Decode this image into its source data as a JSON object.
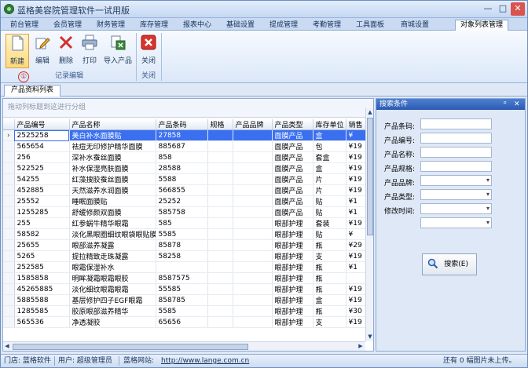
{
  "window": {
    "title": "蓝格美容院管理软件一试用版",
    "min": "—",
    "max": "□",
    "close": "✕"
  },
  "menu_tabs": [
    "前台管理",
    "会员管理",
    "财务管理",
    "库存管理",
    "报表中心",
    "基础设置",
    "提成管理",
    "考勤管理",
    "工具面板",
    "商城设置",
    "对象列表管理"
  ],
  "ribbon": {
    "buttons": {
      "new": "新建",
      "edit": "编辑",
      "delete": "删除",
      "print": "打印",
      "import": "导入产品",
      "close": "关闭"
    },
    "groups": {
      "records": "记录编辑",
      "close": "关闭"
    },
    "badge": "①"
  },
  "doc_tab": "产品资料列表",
  "grid": {
    "group_hint": "拖动列标题到这进行分组",
    "columns": [
      "产品编号",
      "产品名称",
      "产品条码",
      "规格",
      "产品品牌",
      "产品类型",
      "库存单位",
      "销售"
    ],
    "current_row_marker": "›",
    "rows": [
      [
        "2525258",
        "美白补水面膜贴",
        "27858",
        "",
        "",
        "面膜产品",
        "盒",
        "¥"
      ],
      [
        "565654",
        "祛痘无印修护精华面膜",
        "885687",
        "",
        "",
        "面膜产品",
        "包",
        "¥19"
      ],
      [
        "256",
        "深补水蚕丝面膜",
        "858",
        "",
        "",
        "面膜产品",
        "套盒",
        "¥19"
      ],
      [
        "522525",
        "补水保湿亮肤面膜",
        "28588",
        "",
        "",
        "面膜产品",
        "盒",
        "¥19"
      ],
      [
        "54255",
        "红藻搜胶蚕丝面膜",
        "5588",
        "",
        "",
        "面膜产品",
        "片",
        "¥19"
      ],
      [
        "452885",
        "天然滋养水润面膜",
        "566855",
        "",
        "",
        "面膜产品",
        "片",
        "¥19"
      ],
      [
        "25552",
        "睡眠面膜贴",
        "25252",
        "",
        "",
        "面膜产品",
        "贴",
        "¥1"
      ],
      [
        "1255285",
        "舒缓修颜双面膜",
        "585758",
        "",
        "",
        "面膜产品",
        "贴",
        "¥1"
      ],
      [
        "255",
        "红参蜗牛精华眼霜",
        "585",
        "",
        "",
        "眼部护理",
        "套装",
        "¥19"
      ],
      [
        "58582",
        "淡化黑眼圈细纹眼袋眼贴膜",
        "5585",
        "",
        "",
        "眼部护理",
        "贴",
        "¥"
      ],
      [
        "25655",
        "眼部滋养凝露",
        "85878",
        "",
        "",
        "眼部护理",
        "瓶",
        "¥29"
      ],
      [
        "5265",
        "提拉精致走珠凝露",
        "58258",
        "",
        "",
        "眼部护理",
        "支",
        "¥19"
      ],
      [
        "252585",
        "眼霜保湿补水",
        "",
        "",
        "",
        "眼部护理",
        "瓶",
        "¥1"
      ],
      [
        "1585858",
        "明眸凝霜眼霜眼胶",
        "8587575",
        "",
        "",
        "眼部护理",
        "瓶",
        ""
      ],
      [
        "45265885",
        "淡化细纹眼霜眼霜",
        "55585",
        "",
        "",
        "眼部护理",
        "瓶",
        "¥19"
      ],
      [
        "5885588",
        "基层修护四子EGF眼霜",
        "858785",
        "",
        "",
        "眼部护理",
        "盒",
        "¥19"
      ],
      [
        "1285585",
        "胶原眼部滋养精华",
        "5585",
        "",
        "",
        "眼部护理",
        "瓶",
        "¥30"
      ],
      [
        "565536",
        "净透凝胶",
        "65656",
        "",
        "",
        "眼部护理",
        "支",
        "¥19"
      ]
    ]
  },
  "search_panel": {
    "title": "搜索条件",
    "pin": "ᵖ",
    "close": "✕",
    "fields": [
      "产品条码:",
      "产品编号:",
      "产品名称:",
      "产品规格:",
      "产品品牌:",
      "产品类型:",
      "修改时间:"
    ],
    "button": "搜索(E)"
  },
  "status": {
    "store": "门店: 蓝格软件",
    "user": "用户: 超级管理员",
    "site_label": "蓝格网站:",
    "site_url": "http://www.lange.com.cn",
    "right": "还有 0 幅图片未上传。"
  },
  "colors": {
    "selection": "#3a6ff0",
    "accent": "#2b5bb3",
    "badge": "#d32f2f"
  }
}
